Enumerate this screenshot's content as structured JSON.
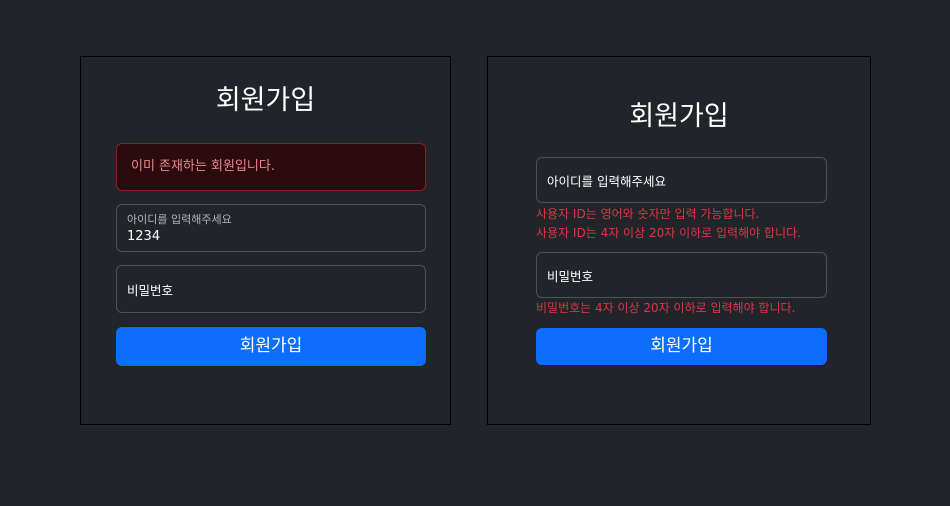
{
  "left_form": {
    "title": "회원가입",
    "alert": "이미 존재하는 회원입니다.",
    "id_field": {
      "label": "아이디를 입력해주세요",
      "value": "1234"
    },
    "password_field": {
      "placeholder": "비밀번호"
    },
    "submit_label": "회원가입"
  },
  "right_form": {
    "title": "회원가입",
    "id_field": {
      "placeholder": "아이디를 입력해주세요"
    },
    "id_errors": [
      "사용자 ID는 영어와 숫자만 입력 가능합니다.",
      "사용자 ID는 4자 이상 20자 이하로 입력해야 합니다."
    ],
    "password_field": {
      "placeholder": "비밀번호"
    },
    "password_errors": [
      "비밀번호는 4자 이상 20자 이하로 입력해야 합니다."
    ],
    "submit_label": "회원가입"
  },
  "colors": {
    "background": "#212529",
    "primary": "#0d6efd",
    "danger": "#dc3545",
    "alert_background": "#2c0b0e",
    "alert_border": "#842029",
    "alert_text": "#ea868f"
  }
}
